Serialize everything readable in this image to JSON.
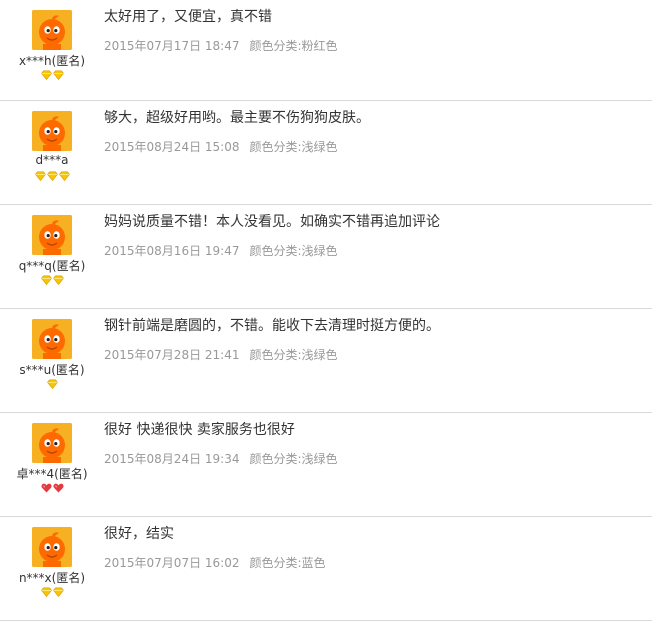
{
  "reviews": [
    {
      "content": "太好用了，又便宜，真不错",
      "date": "2015年07月17日 18:47",
      "sku": "颜色分类:粉红色",
      "user": "x***h(匿名)",
      "badge_count": 2,
      "badge_type": "diamond-yellow"
    },
    {
      "content": "够大，超级好用哟。最主要不伤狗狗皮肤。",
      "date": "2015年08月24日 15:08",
      "sku": "颜色分类:浅绿色",
      "user": "d***a",
      "badge_count": 3,
      "badge_type": "diamond-yellow"
    },
    {
      "content": "妈妈说质量不错！本人没看见。如确实不错再追加评论",
      "date": "2015年08月16日 19:47",
      "sku": "颜色分类:浅绿色",
      "user": "q***q(匿名)",
      "badge_count": 2,
      "badge_type": "diamond-yellow"
    },
    {
      "content": "钢针前端是磨圆的，不错。能收下去清理时挺方便的。",
      "date": "2015年07月28日 21:41",
      "sku": "颜色分类:浅绿色",
      "user": "s***u(匿名)",
      "badge_count": 1,
      "badge_type": "diamond-yellow"
    },
    {
      "content": "很好 快递很快 卖家服务也很好",
      "date": "2015年08月24日 19:34",
      "sku": "颜色分类:浅绿色",
      "user": "卓***4(匿名)",
      "badge_count": 2,
      "badge_type": "heart-red"
    },
    {
      "content": "很好，结实",
      "date": "2015年07月07日 16:02",
      "sku": "颜色分类:蓝色",
      "user": "n***x(匿名)",
      "badge_count": 2,
      "badge_type": "diamond-yellow"
    }
  ],
  "colors": {
    "avatar_bg": "#f6b021",
    "meta_text": "#999999",
    "content_text": "#333333",
    "divider": "#d9d9d9",
    "badge_yellow": "#f7c600",
    "badge_red": "#e8383d"
  }
}
